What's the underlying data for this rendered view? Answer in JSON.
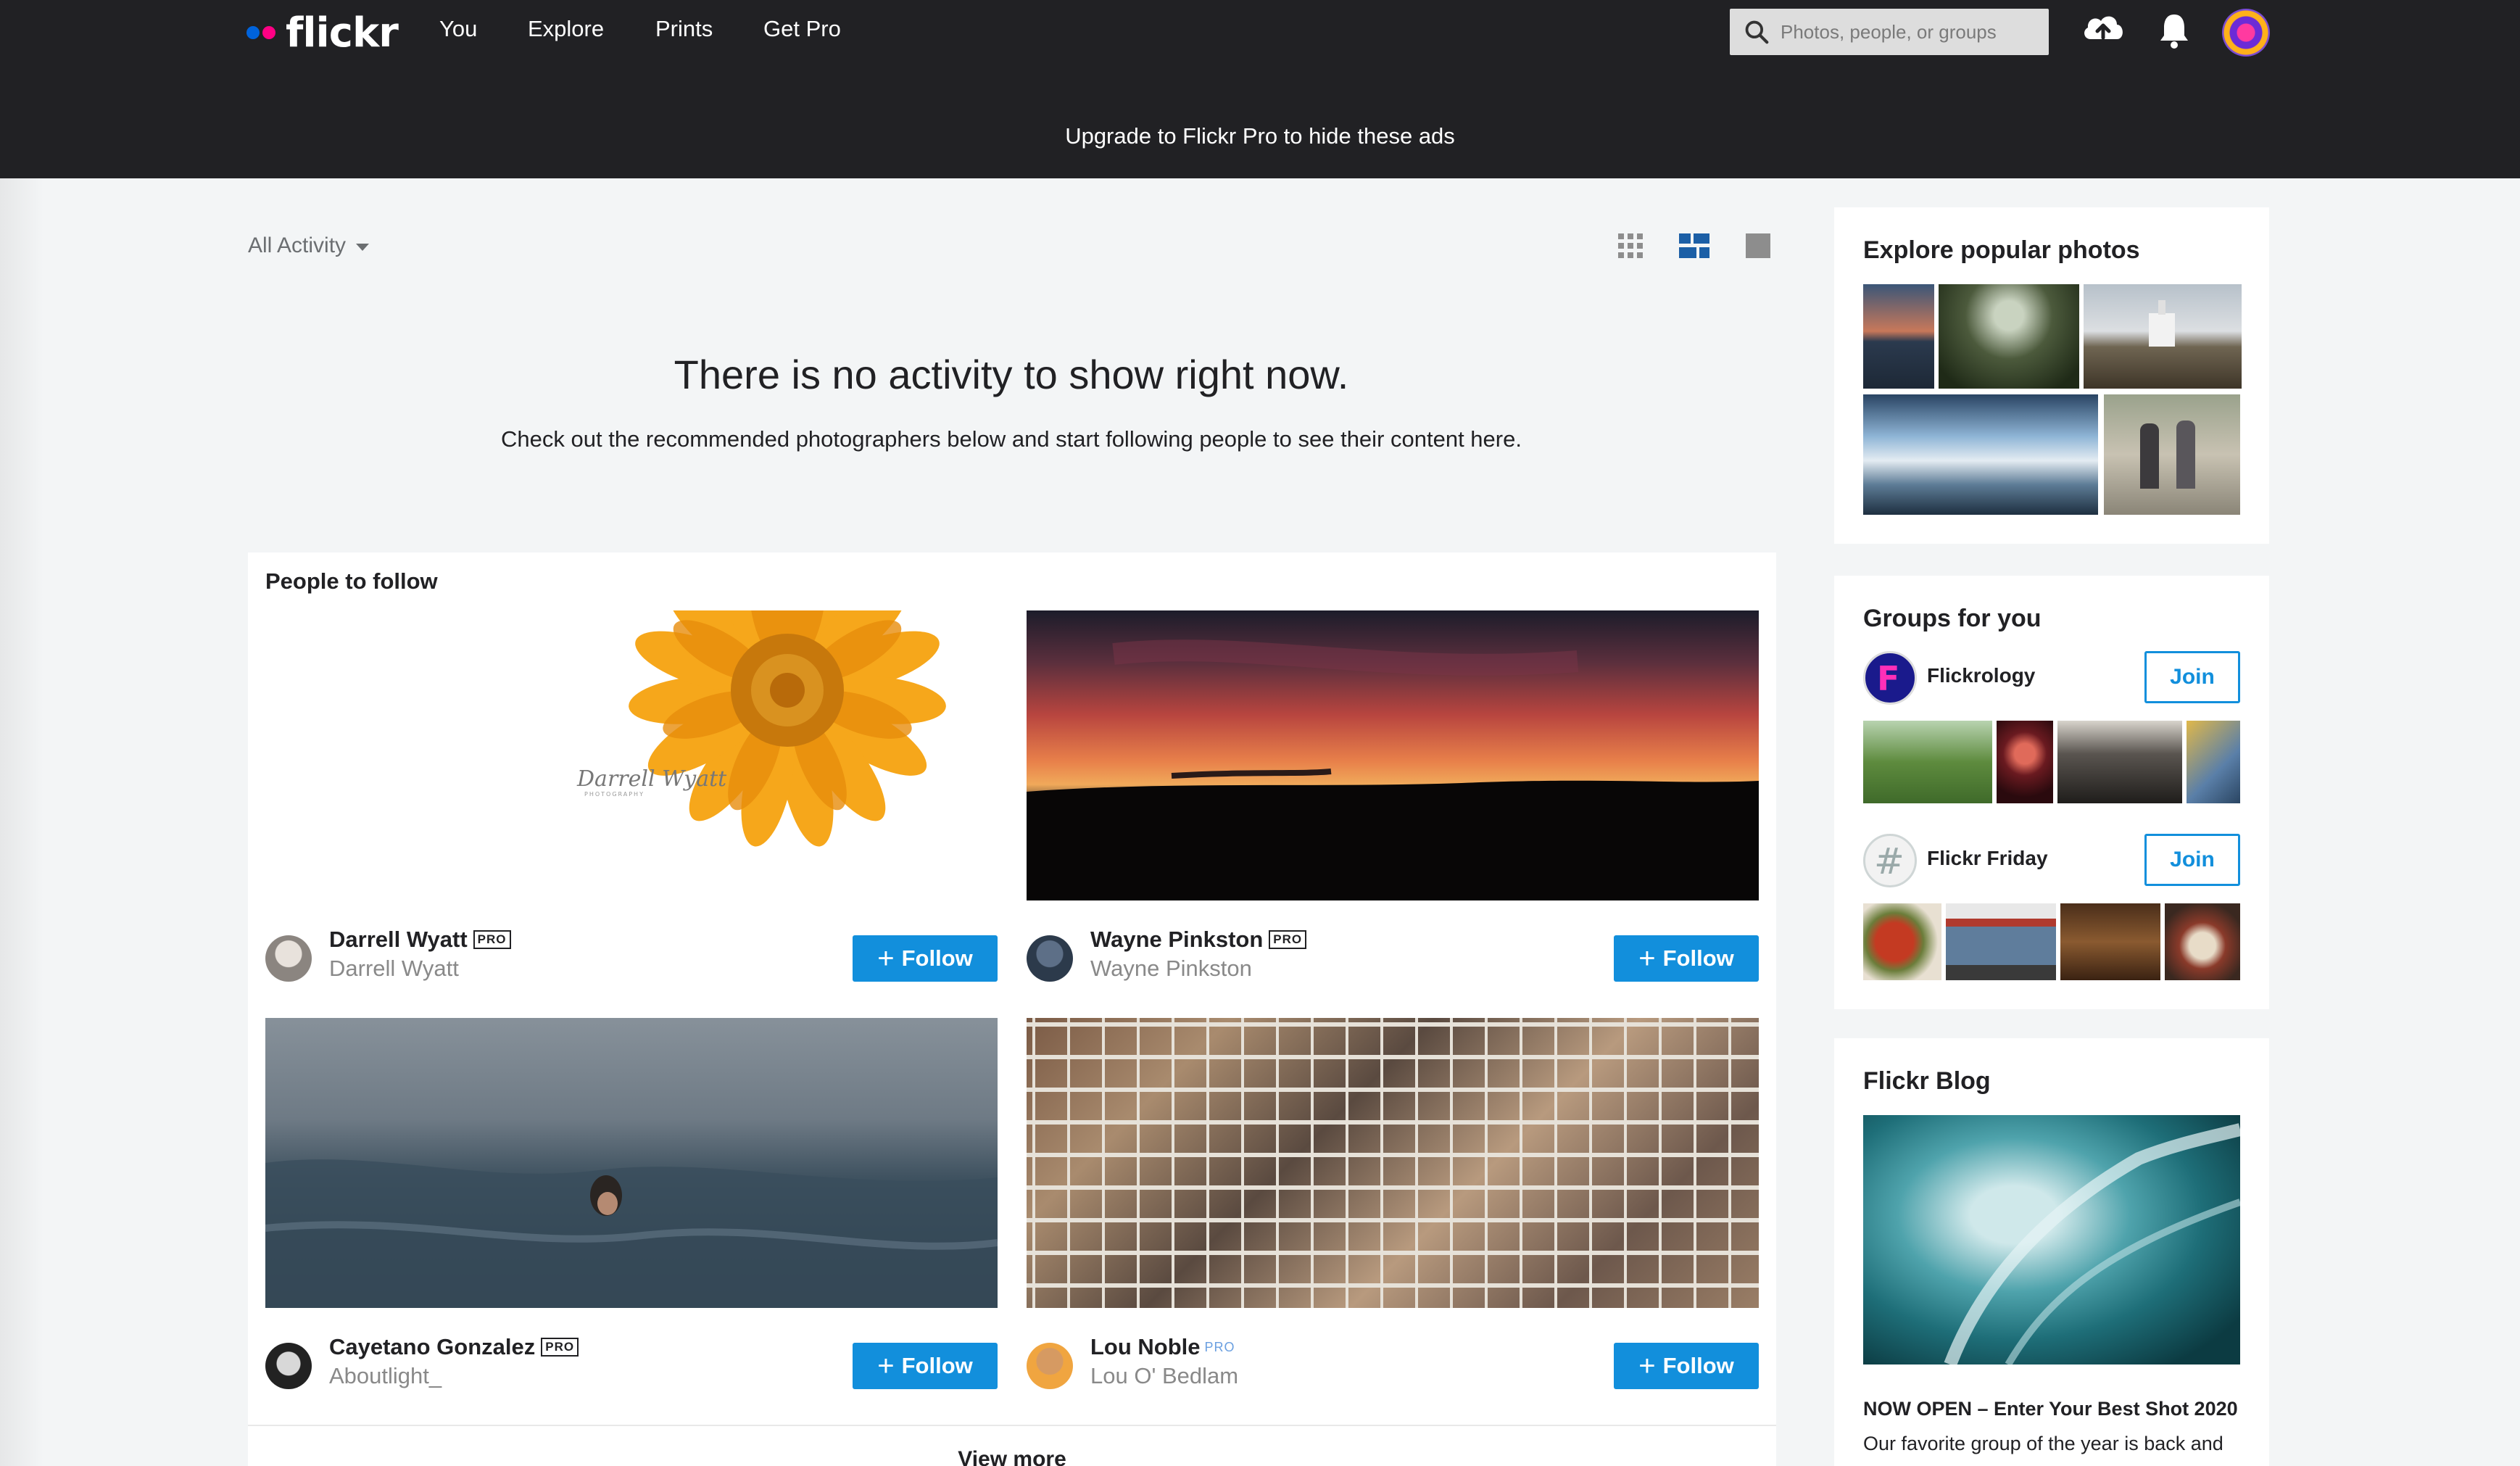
{
  "topbar": {
    "logo_text": "flickr",
    "nav": [
      "You",
      "Explore",
      "Prints",
      "Get Pro"
    ],
    "search_placeholder": "Photos, people, or groups",
    "upgrade_text": "Upgrade to Flickr Pro to hide these ads",
    "icons": [
      "upload-cloud-icon",
      "bell-icon",
      "avatar"
    ]
  },
  "feed": {
    "filter_label": "All Activity",
    "view_modes": [
      "grid-view",
      "list-view",
      "single-view"
    ],
    "selected_view": "list-view",
    "empty_title": "There is no activity to show right now.",
    "empty_subtitle": "Check out the recommended photographers below and start following people to see their content here."
  },
  "people": {
    "title": "People to follow",
    "follow_label": "Follow",
    "view_more": "View more",
    "items": [
      {
        "name": "Darrell Wyatt",
        "username": "Darrell Wyatt",
        "badge": "PRO"
      },
      {
        "name": "Wayne Pinkston",
        "username": "Wayne Pinkston",
        "badge": "PRO"
      },
      {
        "name": "Cayetano Gonzalez",
        "username": "Aboutlight_",
        "badge": "PRO"
      },
      {
        "name": "Lou Noble",
        "username": "Lou O' Bedlam",
        "badge": "PRO"
      }
    ]
  },
  "sidebar": {
    "explore_title": "Explore popular photos",
    "groups_title": "Groups for you",
    "join_label": "Join",
    "groups": [
      {
        "name": "Flickrology"
      },
      {
        "name": "Flickr Friday"
      }
    ],
    "blog_title": "Flickr Blog",
    "blog_headline": "NOW OPEN – Enter Your Best Shot 2020",
    "blog_text": "Our favorite group of the year is back and"
  },
  "colors": {
    "topbar": "#212124",
    "accent_blue": "#128fdc",
    "logo_blue": "#0063dc",
    "logo_pink": "#ff0084"
  }
}
